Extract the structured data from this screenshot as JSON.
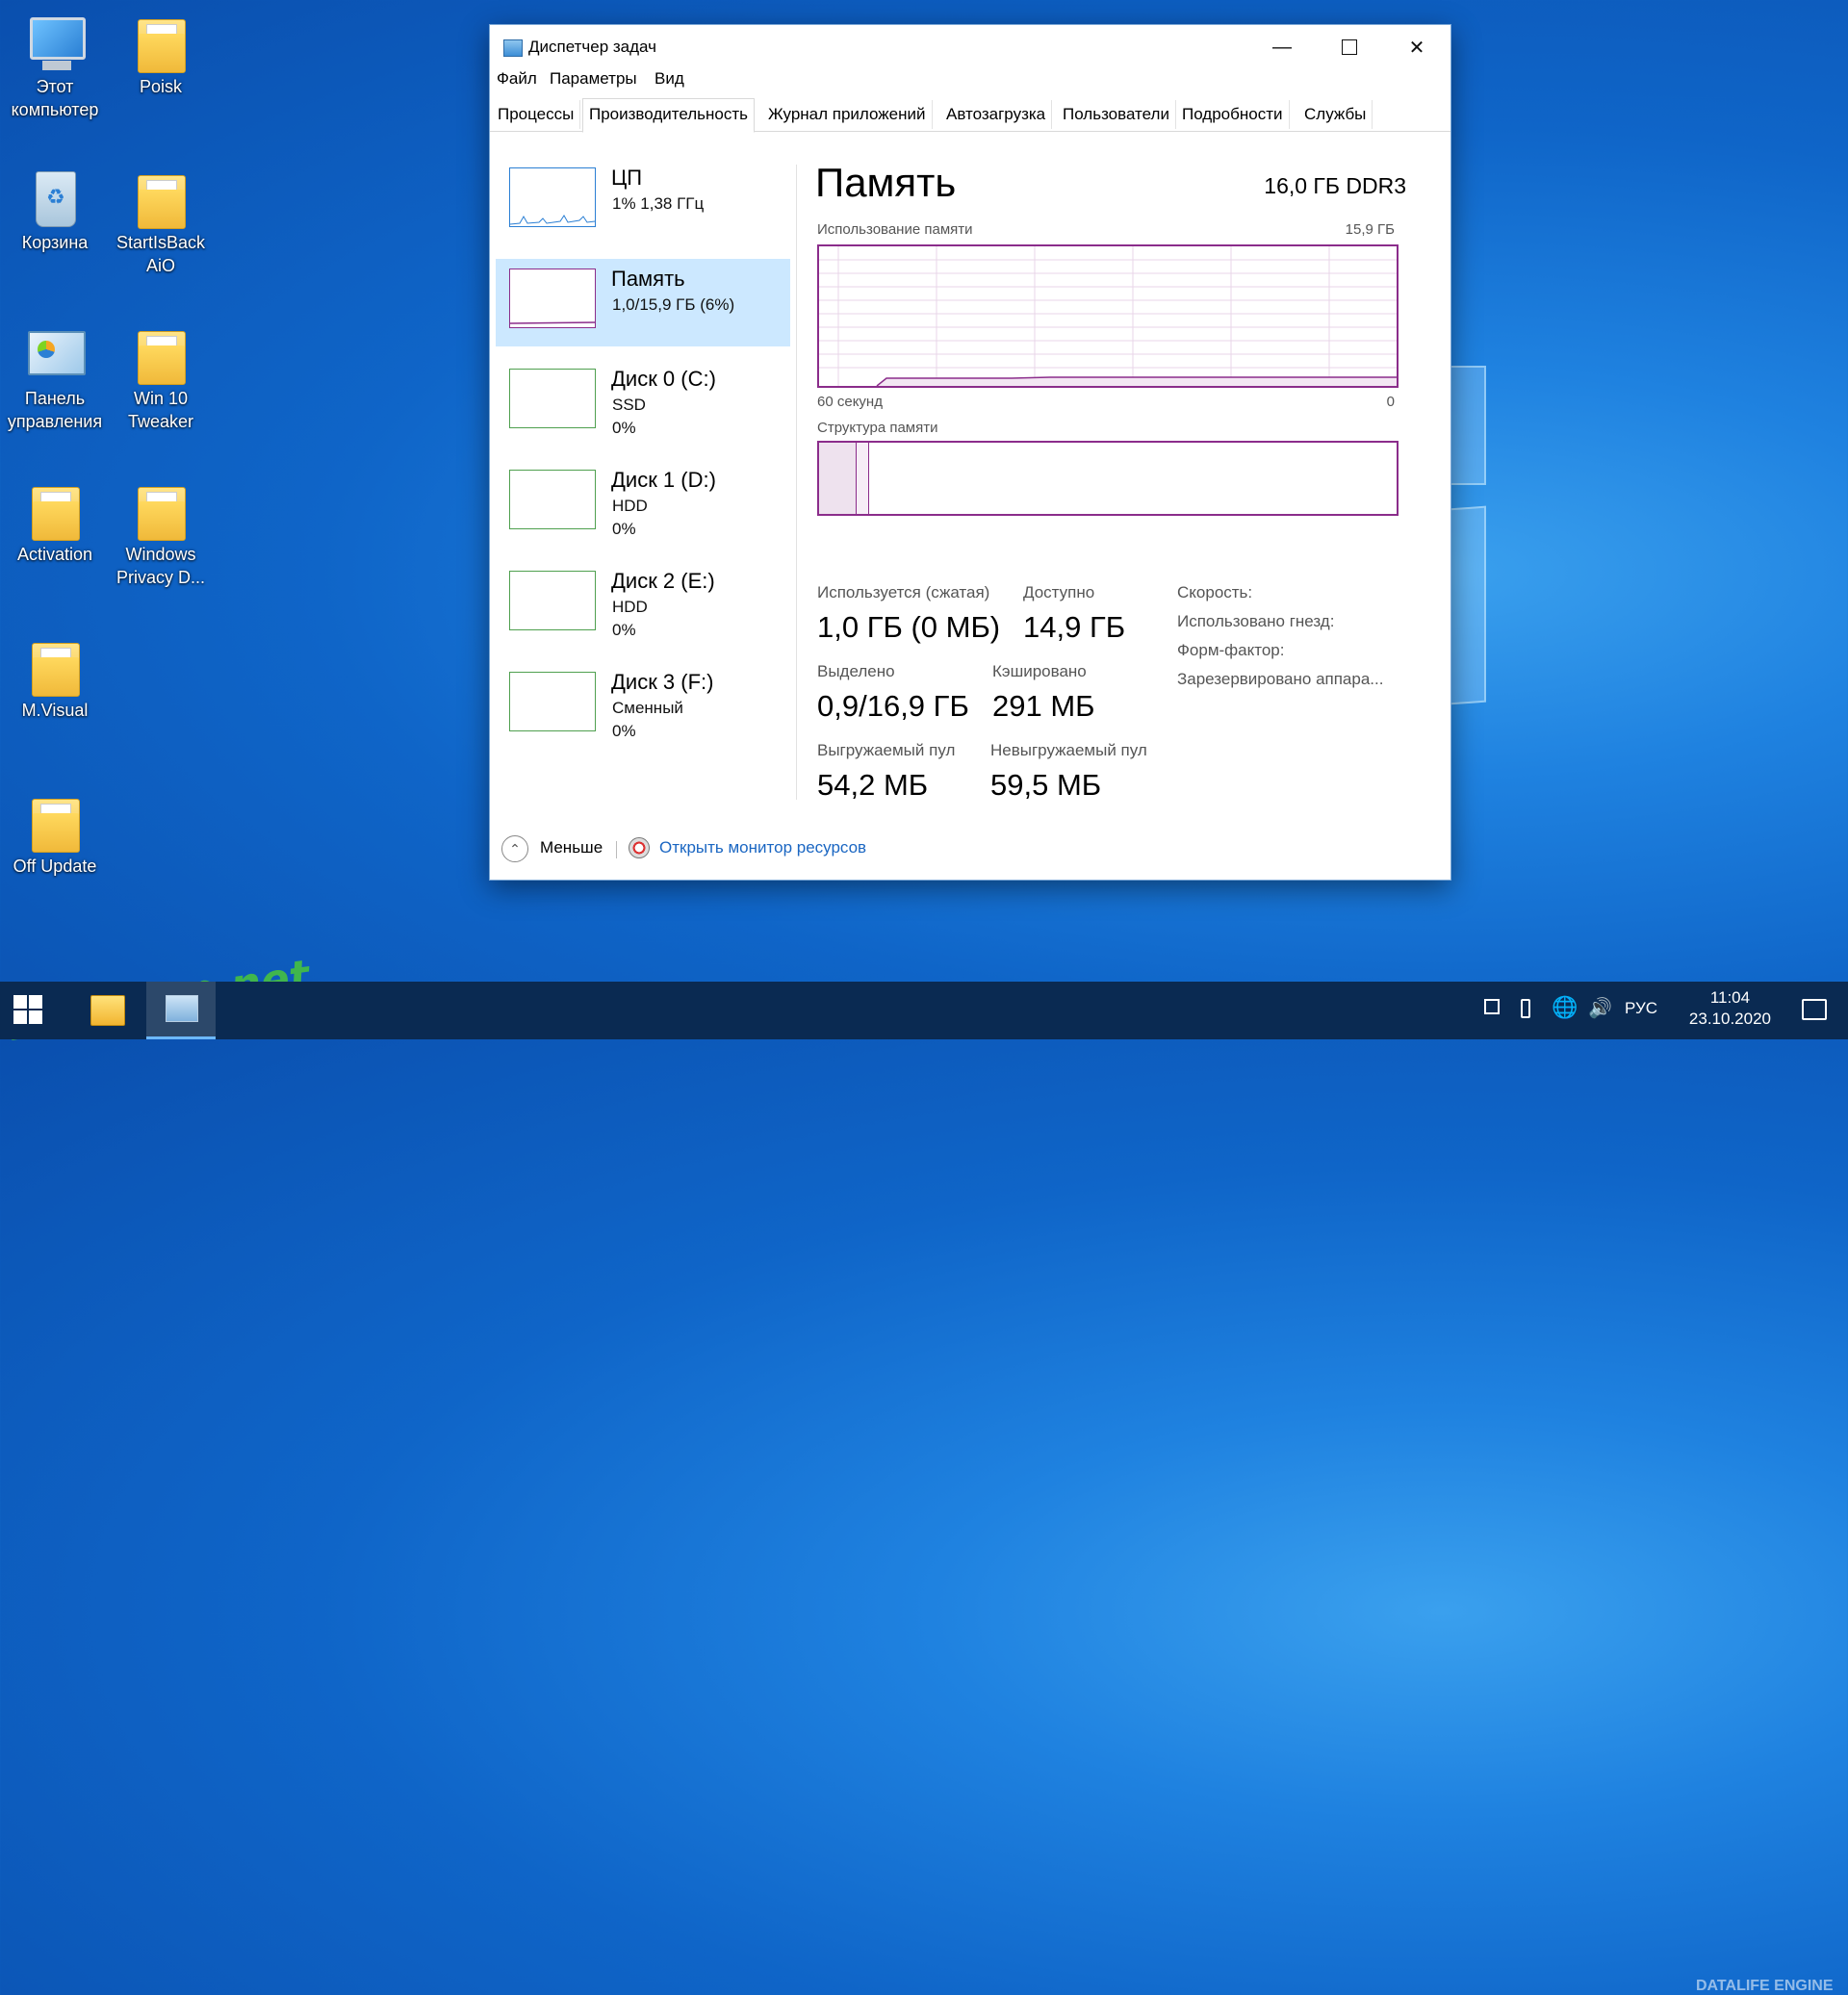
{
  "desktop": {
    "icons": [
      {
        "label": "Этот компьютер",
        "type": "monitor"
      },
      {
        "label": "Poisk",
        "type": "folder"
      },
      {
        "label": "Корзина",
        "type": "bin"
      },
      {
        "label": "StartIsBack AiO",
        "type": "folder"
      },
      {
        "label": "Панель управления",
        "type": "panel"
      },
      {
        "label": "Win 10 Tweaker",
        "type": "folder"
      },
      {
        "label": "Activation",
        "type": "folder"
      },
      {
        "label": "Windows Privacy D...",
        "type": "folder"
      },
      {
        "label": "M.Visual",
        "type": "folder"
      },
      {
        "label": "Off Update",
        "type": "folder"
      }
    ]
  },
  "window": {
    "title": "Диспетчер задач",
    "menu": [
      "Файл",
      "Параметры",
      "Вид"
    ],
    "tabs": [
      "Процессы",
      "Производительность",
      "Журнал приложений",
      "Автозагрузка",
      "Пользователи",
      "Подробности",
      "Службы"
    ],
    "active_tab": "Производительность",
    "left": [
      {
        "name": "ЦП",
        "sub": "1%  1,38 ГГц",
        "sub2": ""
      },
      {
        "name": "Память",
        "sub": "1,0/15,9 ГБ (6%)",
        "sub2": ""
      },
      {
        "name": "Диск 0 (C:)",
        "sub": "SSD",
        "sub2": "0%"
      },
      {
        "name": "Диск 1 (D:)",
        "sub": "HDD",
        "sub2": "0%"
      },
      {
        "name": "Диск 2 (E:)",
        "sub": "HDD",
        "sub2": "0%"
      },
      {
        "name": "Диск 3 (F:)",
        "sub": "Сменный",
        "sub2": "0%"
      }
    ],
    "main": {
      "title": "Память",
      "spec": "16,0 ГБ DDR3",
      "usage_label": "Использование памяти",
      "usage_max": "15,9 ГБ",
      "axis_left": "60 секунд",
      "axis_right": "0",
      "structure_label": "Структура памяти",
      "stats": {
        "in_use_label": "Используется (сжатая)",
        "in_use_value": "1,0 ГБ (0 МБ)",
        "available_label": "Доступно",
        "available_value": "14,9 ГБ",
        "committed_label": "Выделено",
        "committed_value": "0,9/16,9 ГБ",
        "cached_label": "Кэшировано",
        "cached_value": "291 МБ",
        "paged_label": "Выгружаемый пул",
        "paged_value": "54,2 МБ",
        "nonpaged_label": "Невыгружаемый пул",
        "nonpaged_value": "59,5 МБ"
      },
      "side": {
        "speed": "Скорость:",
        "slots": "Использовано гнезд:",
        "form": "Форм-фактор:",
        "reserved": "Зарезервировано аппара..."
      }
    },
    "footer": {
      "fewer": "Меньше",
      "resmon": "Открыть монитор ресурсов"
    }
  },
  "taskbar": {
    "lang": "РУС",
    "time": "11:04",
    "date": "23.10.2020"
  },
  "watermarks": {
    "top_left": "prog-top.net",
    "bottom_right": "DATALIFE ENGINE"
  },
  "colors": {
    "memory_accent": "#8b2d8b",
    "selected_bg": "#cce8ff",
    "link": "#1a66c2"
  }
}
